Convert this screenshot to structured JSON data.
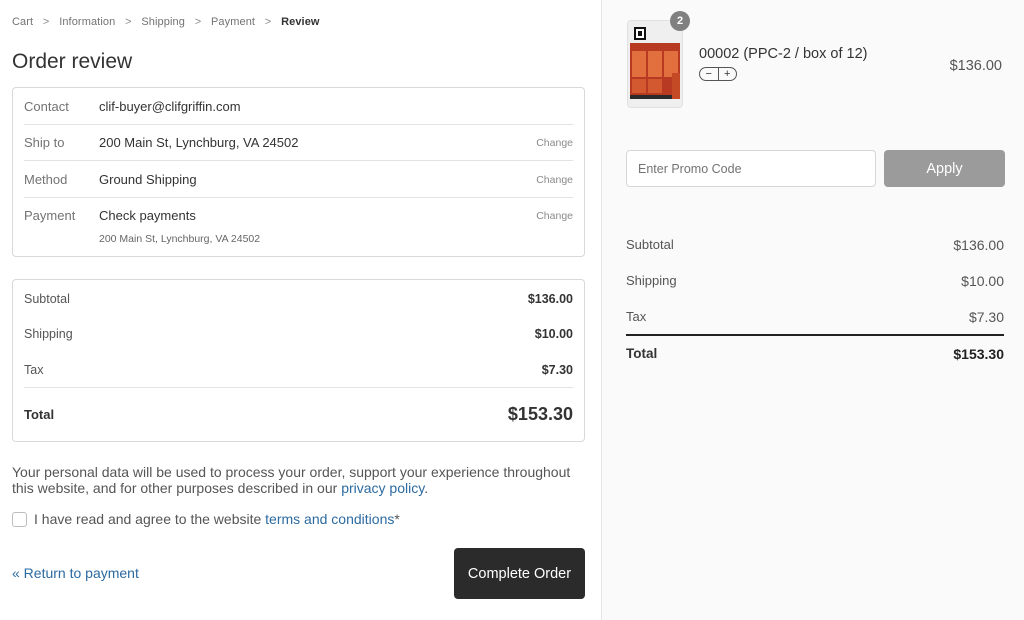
{
  "breadcrumb": {
    "items": [
      "Cart",
      "Information",
      "Shipping",
      "Payment"
    ],
    "current": "Review",
    "separator": ">"
  },
  "page_title": "Order review",
  "review": {
    "contact": {
      "label": "Contact",
      "value": "clif-buyer@clifgriffin.com"
    },
    "ship_to": {
      "label": "Ship to",
      "value": "200 Main St, Lynchburg, VA 24502",
      "change": "Change"
    },
    "method": {
      "label": "Method",
      "value": "Ground Shipping",
      "change": "Change"
    },
    "payment": {
      "label": "Payment",
      "value": "Check payments",
      "change": "Change",
      "sub": "200 Main St, Lynchburg, VA 24502"
    }
  },
  "totals": {
    "subtotal": {
      "label": "Subtotal",
      "value": "$136.00"
    },
    "shipping": {
      "label": "Shipping",
      "value": "$10.00"
    },
    "tax": {
      "label": "Tax",
      "value": "$7.30"
    },
    "total": {
      "label": "Total",
      "value": "$153.30"
    }
  },
  "privacy": {
    "text": "Your personal data will be used to process your order, support your experience throughout this website, and for other purposes described in our ",
    "link": "privacy policy",
    "end": "."
  },
  "terms": {
    "text": "I have read and agree to the website ",
    "link": "terms and conditions",
    "required": "*"
  },
  "actions": {
    "return": "« Return to payment",
    "complete": "Complete Order"
  },
  "cart": {
    "product": {
      "name": "00002 (PPC-2 / box of 12)",
      "price": "$136.00",
      "quantity": "2",
      "minus": "−",
      "plus": "+"
    },
    "promo": {
      "placeholder": "Enter Promo Code",
      "button": "Apply"
    },
    "summary": {
      "subtotal": {
        "label": "Subtotal",
        "value": "$136.00"
      },
      "shipping": {
        "label": "Shipping",
        "value": "$10.00"
      },
      "tax": {
        "label": "Tax",
        "value": "$7.30"
      },
      "total": {
        "label": "Total",
        "value": "$153.30"
      }
    }
  },
  "colors": {
    "link": "#2c6aa0",
    "button_dark": "#2b2b2b",
    "button_disabled": "#9b9b9b"
  }
}
